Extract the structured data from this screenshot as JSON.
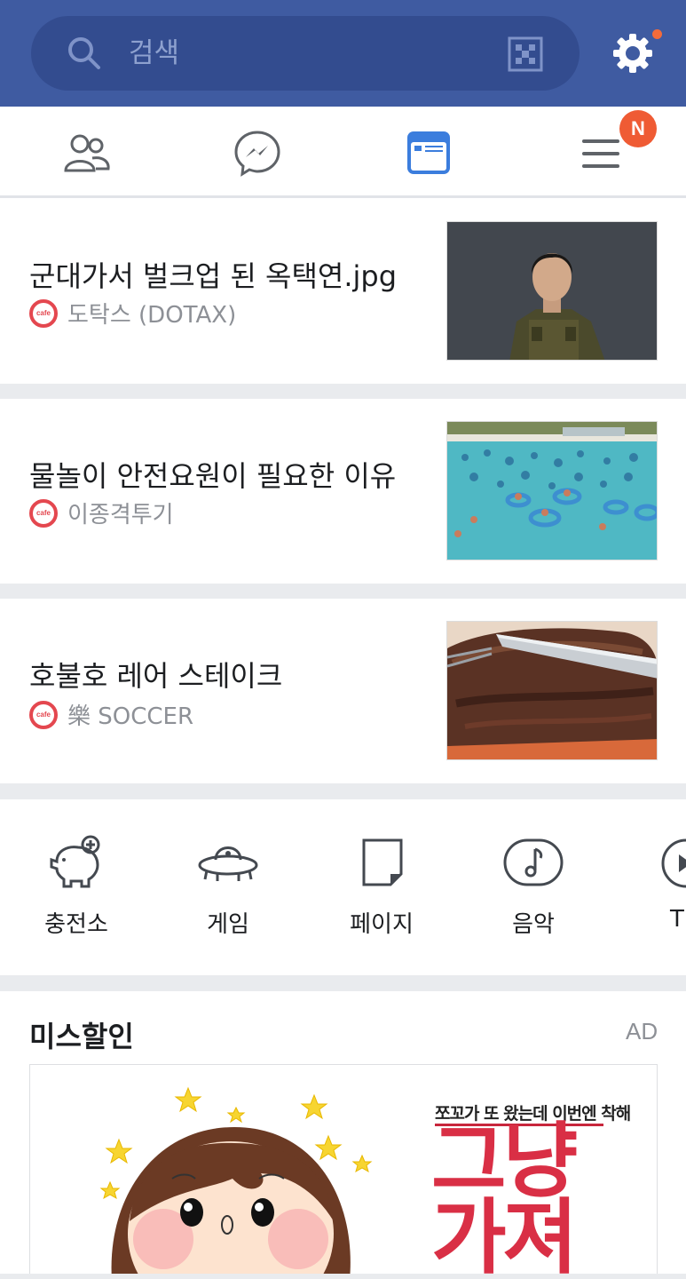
{
  "search": {
    "placeholder": "검색"
  },
  "icons": {
    "search": "search-icon",
    "qr": "qr-code-icon",
    "settings": "gear-icon",
    "tabs": [
      "friends-icon",
      "messenger-icon",
      "news-feed-icon",
      "menu-icon"
    ]
  },
  "tabs": {
    "menu_badge": "N"
  },
  "feed": [
    {
      "title": "군대가서 벌크업 된 옥택연.jpg",
      "source": "도탁스 (DOTAX)",
      "source_icon": "cafe"
    },
    {
      "title": "물놀이 안전요원이 필요한 이유",
      "source": "이종격투기",
      "source_icon": "cafe"
    },
    {
      "title": "호불호 레어 스테이크",
      "source": "樂 SOCCER",
      "source_icon": "cafe"
    }
  ],
  "shortcuts": [
    {
      "label": "충전소",
      "icon": "piggy-bank-icon"
    },
    {
      "label": "게임",
      "icon": "ufo-icon"
    },
    {
      "label": "페이지",
      "icon": "page-icon"
    },
    {
      "label": "음악",
      "icon": "music-icon"
    },
    {
      "label": "T",
      "icon": "play-icon"
    }
  ],
  "ad": {
    "title": "미스할인",
    "label": "AD",
    "banner_subtitle": "쪼꼬가 또 왔는데 이번엔 착해",
    "banner_headline": "그냥 가져"
  },
  "colors": {
    "header": "#3f5ba1",
    "search_bg": "#334c8f",
    "active_tab": "#3b7ddd",
    "badge": "#ef5b34",
    "cafe_icon": "#e4474f",
    "ad_headline": "#d92f45"
  }
}
